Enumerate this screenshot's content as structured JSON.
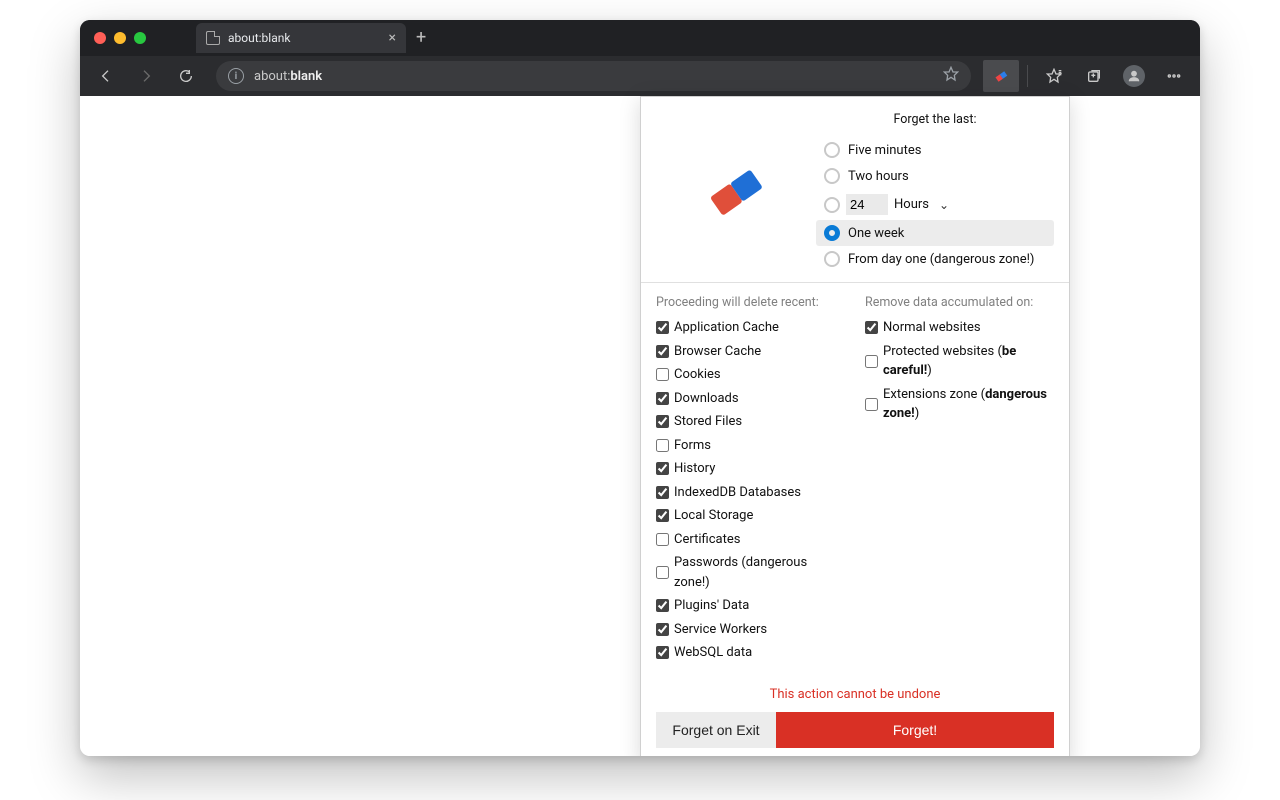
{
  "browser": {
    "tab_title": "about:blank",
    "url_scheme": "about:",
    "url_path": "blank"
  },
  "popup": {
    "forget_label": "Forget the last:",
    "time_options": {
      "five": "Five minutes",
      "two_hours": "Two hours",
      "hours_value": "24",
      "hours_unit": "Hours",
      "one_week": "One week",
      "day_one": "From day one (dangerous zone!)"
    },
    "selected_time": "one_week",
    "left_header": "Proceeding will delete recent:",
    "left_items": [
      {
        "label": "Application Cache",
        "checked": true
      },
      {
        "label": "Browser Cache",
        "checked": true
      },
      {
        "label": "Cookies",
        "checked": false
      },
      {
        "label": "Downloads",
        "checked": true
      },
      {
        "label": "Stored Files",
        "checked": true
      },
      {
        "label": "Forms",
        "checked": false
      },
      {
        "label": "History",
        "checked": true
      },
      {
        "label": "IndexedDB Databases",
        "checked": true
      },
      {
        "label": "Local Storage",
        "checked": true
      },
      {
        "label": "Certificates",
        "checked": false
      },
      {
        "label": "Passwords (dangerous zone!)",
        "checked": false
      },
      {
        "label": "Plugins' Data",
        "checked": true
      },
      {
        "label": "Service Workers",
        "checked": true
      },
      {
        "label": "WebSQL data",
        "checked": true
      }
    ],
    "right_header": "Remove data accumulated on:",
    "right_items": [
      {
        "label": "Normal websites",
        "bold": "",
        "checked": true
      },
      {
        "label": "Protected websites (",
        "bold": "be careful!",
        "tail": ")",
        "checked": false
      },
      {
        "label": "Extensions zone (",
        "bold": "dangerous zone!",
        "tail": ")",
        "checked": false
      }
    ],
    "warning": "This action cannot be undone",
    "forget_on_exit": "Forget on Exit",
    "forget": "Forget!"
  }
}
